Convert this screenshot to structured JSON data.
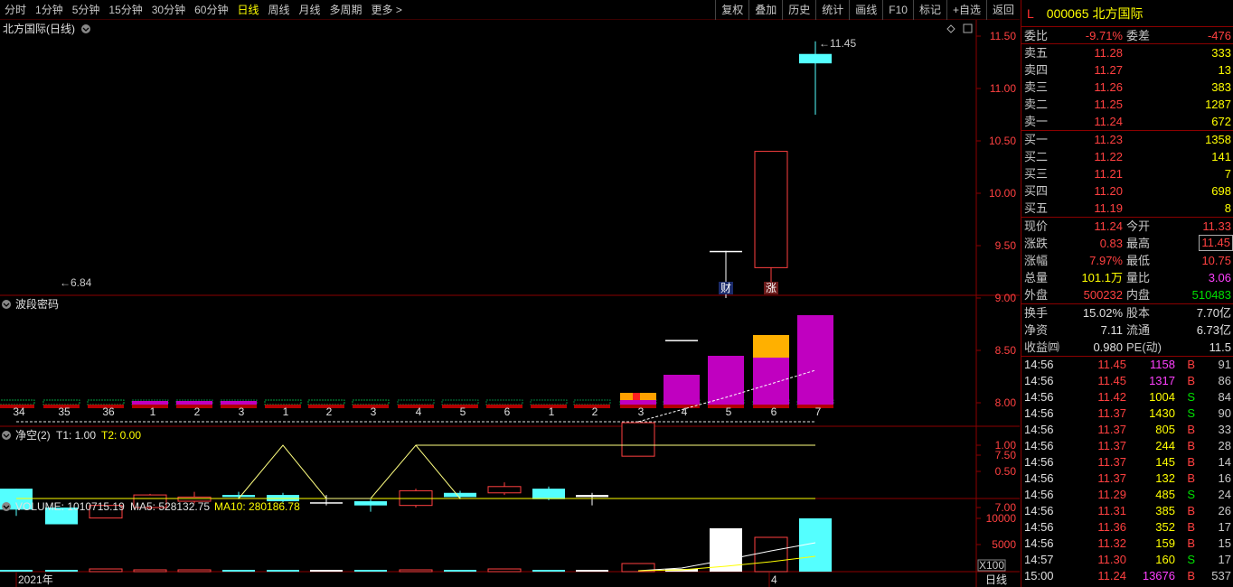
{
  "toolbar": {
    "periods": [
      "分时",
      "1分钟",
      "5分钟",
      "15分钟",
      "30分钟",
      "60分钟",
      "日线",
      "周线",
      "月线",
      "多周期",
      "更多 >"
    ],
    "active": 6,
    "buttons": [
      "复权",
      "叠加",
      "历史",
      "统计",
      "画线",
      "F10",
      "标记",
      "+自选",
      "返回"
    ]
  },
  "main": {
    "title": "北方国际(日线)",
    "price_axis": [
      "11.50",
      "11.00",
      "10.50",
      "10.00",
      "9.50",
      "9.00",
      "8.50",
      "8.00",
      "7.50",
      "7.00"
    ],
    "high_label": "11.45",
    "low_label": "6.84",
    "markers": [
      "财",
      "涨"
    ]
  },
  "indicator1": {
    "title": "波段密码",
    "counts": [
      "34",
      "35",
      "36",
      "1",
      "2",
      "3",
      "1",
      "2",
      "3",
      "4",
      "5",
      "6",
      "1",
      "2",
      "3",
      "4",
      "5",
      "6",
      "7"
    ]
  },
  "indicator2": {
    "title": "净空(2)",
    "t1": "T1: 1.00",
    "t2": "T2: 0.00",
    "axis": [
      "1.00",
      "0.50"
    ]
  },
  "volume": {
    "title": "VOLUME: 1010715.19",
    "ma5": "MA5: 528132.75",
    "ma10": "MA10: 280186.78",
    "axis": [
      "10000",
      "5000"
    ],
    "unit": "X100"
  },
  "bottom": {
    "year": "2021年",
    "month": "4",
    "period": "日线"
  },
  "quote": {
    "l": "L",
    "code": "000065",
    "name": "北方国际",
    "weibi": {
      "label": "委比",
      "value": "-9.71%",
      "label2": "委差",
      "value2": "-476"
    },
    "asks": [
      {
        "label": "卖五",
        "price": "11.28",
        "vol": "333"
      },
      {
        "label": "卖四",
        "price": "11.27",
        "vol": "13"
      },
      {
        "label": "卖三",
        "price": "11.26",
        "vol": "383"
      },
      {
        "label": "卖二",
        "price": "11.25",
        "vol": "1287"
      },
      {
        "label": "卖一",
        "price": "11.24",
        "vol": "672"
      }
    ],
    "bids": [
      {
        "label": "买一",
        "price": "11.23",
        "vol": "1358"
      },
      {
        "label": "买二",
        "price": "11.22",
        "vol": "141"
      },
      {
        "label": "买三",
        "price": "11.21",
        "vol": "7"
      },
      {
        "label": "买四",
        "price": "11.20",
        "vol": "698"
      },
      {
        "label": "买五",
        "price": "11.19",
        "vol": "8"
      }
    ],
    "stats": [
      {
        "l1": "现价",
        "v1": "11.24",
        "l2": "今开",
        "v2": "11.33"
      },
      {
        "l1": "涨跌",
        "v1": "0.83",
        "l2": "最高",
        "v2": "11.45"
      },
      {
        "l1": "涨幅",
        "v1": "7.97%",
        "l2": "最低",
        "v2": "10.75"
      },
      {
        "l1": "总量",
        "v1": "101.1万",
        "l2": "量比",
        "v2": "3.06"
      },
      {
        "l1": "外盘",
        "v1": "500232",
        "l2": "内盘",
        "v2": "510483"
      }
    ],
    "stats2": [
      {
        "l1": "换手",
        "v1": "15.02%",
        "l2": "股本",
        "v2": "7.70亿"
      },
      {
        "l1": "净资",
        "v1": "7.11",
        "l2": "流通",
        "v2": "6.73亿"
      },
      {
        "l1": "收益㈣",
        "v1": "0.980",
        "l2": "PE(动)",
        "v2": "11.5"
      }
    ],
    "ticks": [
      {
        "t": "14:56",
        "p": "11.45",
        "v": "1158",
        "bs": "B",
        "n": "91"
      },
      {
        "t": "14:56",
        "p": "11.45",
        "v": "1317",
        "bs": "B",
        "n": "86"
      },
      {
        "t": "14:56",
        "p": "11.42",
        "v": "1004",
        "bs": "S",
        "n": "84"
      },
      {
        "t": "14:56",
        "p": "11.37",
        "v": "1430",
        "bs": "S",
        "n": "90"
      },
      {
        "t": "14:56",
        "p": "11.37",
        "v": "805",
        "bs": "B",
        "n": "33"
      },
      {
        "t": "14:56",
        "p": "11.37",
        "v": "244",
        "bs": "B",
        "n": "28"
      },
      {
        "t": "14:56",
        "p": "11.37",
        "v": "145",
        "bs": "B",
        "n": "14"
      },
      {
        "t": "14:56",
        "p": "11.37",
        "v": "132",
        "bs": "B",
        "n": "16"
      },
      {
        "t": "14:56",
        "p": "11.29",
        "v": "485",
        "bs": "S",
        "n": "24"
      },
      {
        "t": "14:56",
        "p": "11.31",
        "v": "385",
        "bs": "B",
        "n": "26"
      },
      {
        "t": "14:56",
        "p": "11.36",
        "v": "352",
        "bs": "B",
        "n": "17"
      },
      {
        "t": "14:56",
        "p": "11.32",
        "v": "159",
        "bs": "B",
        "n": "15"
      },
      {
        "t": "14:57",
        "p": "11.30",
        "v": "160",
        "bs": "S",
        "n": "17"
      },
      {
        "t": "15:00",
        "p": "11.24",
        "v": "13676",
        "bs": "B",
        "n": "537"
      }
    ]
  }
}
